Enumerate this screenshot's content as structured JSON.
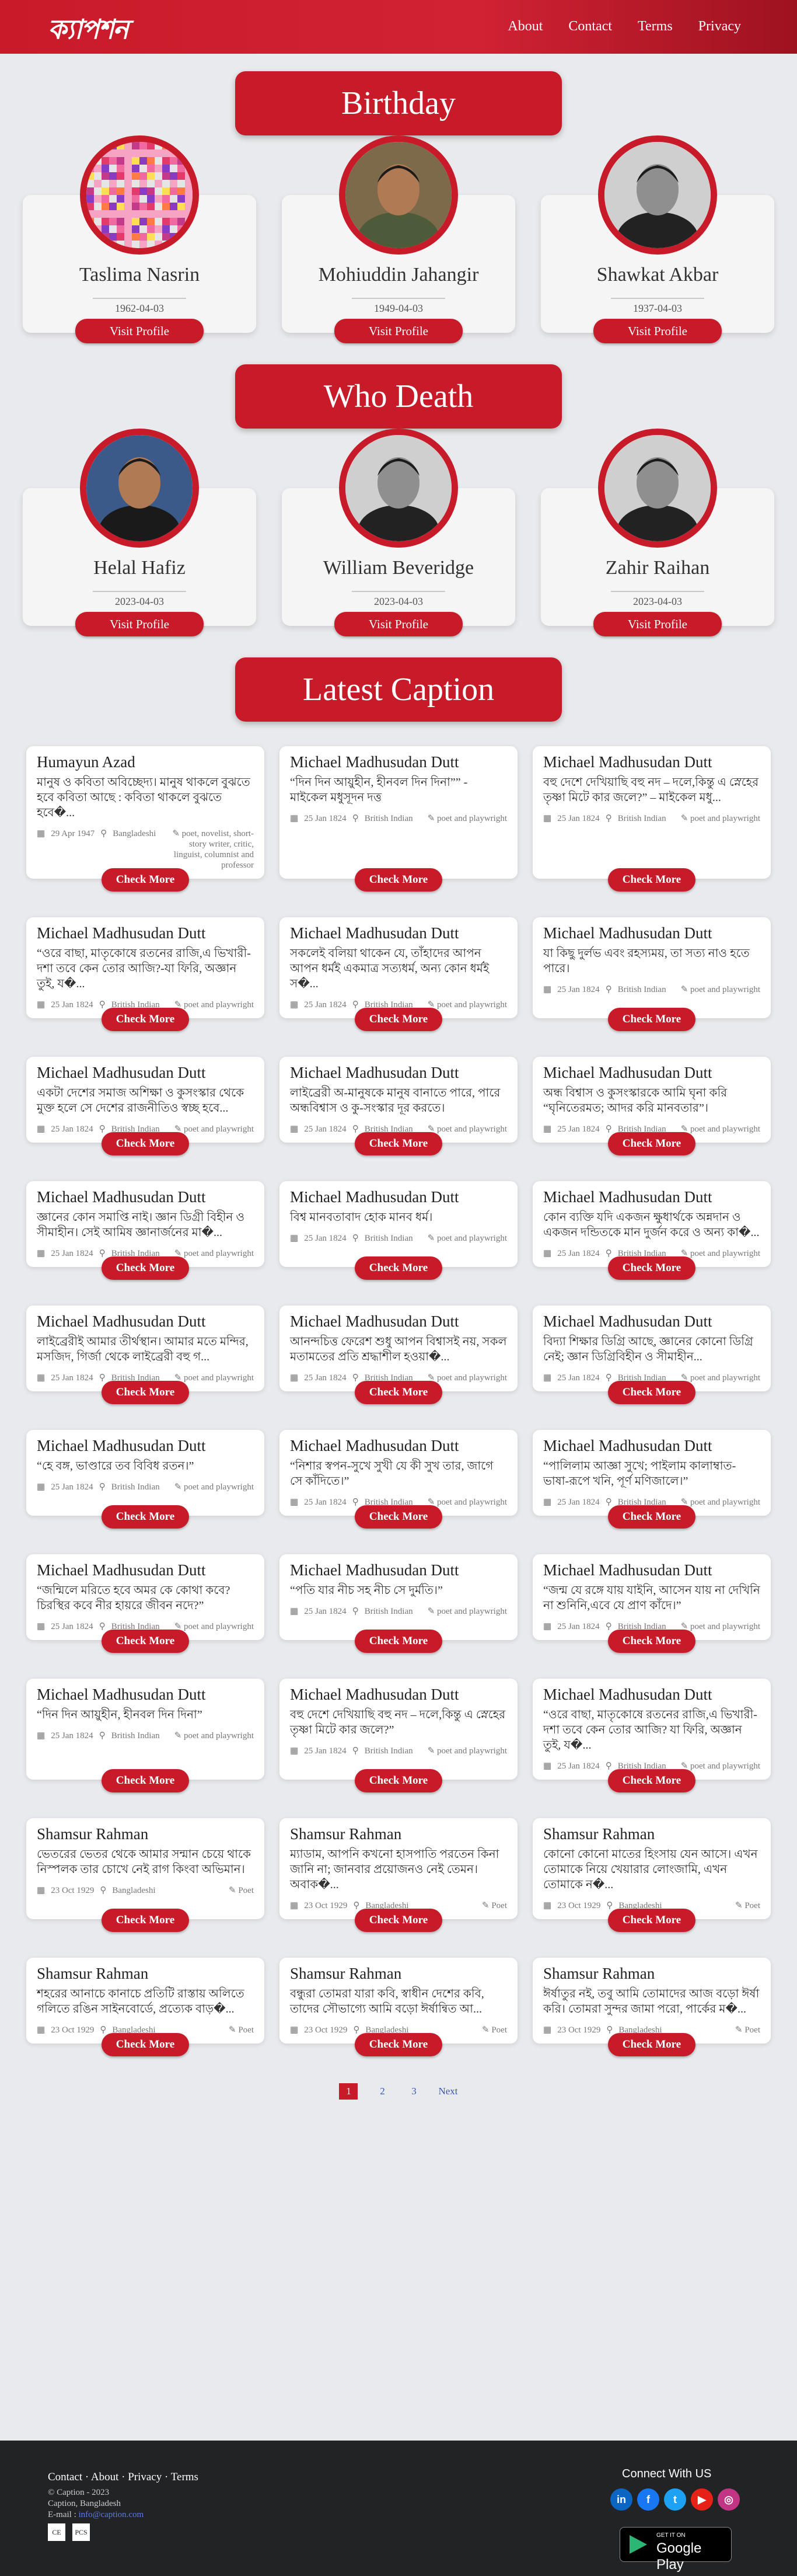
{
  "header": {
    "logo": "ক্যাপশন",
    "nav": [
      "About",
      "Contact",
      "Terms",
      "Privacy"
    ]
  },
  "birthday": {
    "title": "Birthday",
    "people": [
      {
        "name": "Taslima Nasrin",
        "date": "1962-04-03",
        "button": "Visit Profile",
        "photo": "portrait-collage"
      },
      {
        "name": "Mohiuddin Jahangir",
        "date": "1949-04-03",
        "button": "Visit Profile",
        "photo": "portrait-soldier"
      },
      {
        "name": "Shawkat Akbar",
        "date": "1937-04-03",
        "button": "Visit Profile",
        "photo": "portrait-bw"
      }
    ]
  },
  "death": {
    "title": "Who Death",
    "people": [
      {
        "name": "Helal Hafiz",
        "date": "2023-04-03",
        "button": "Visit Profile",
        "photo": "portrait-color"
      },
      {
        "name": "William Beveridge",
        "date": "2023-04-03",
        "button": "Visit Profile",
        "photo": "portrait-bw"
      },
      {
        "name": "Zahir Raihan",
        "date": "2023-04-03",
        "button": "Visit Profile",
        "photo": "portrait-bw"
      }
    ]
  },
  "captions": {
    "title": "Latest Caption",
    "more_label": "Check More",
    "cards": [
      {
        "author": "Humayun Azad",
        "text": "মানুষ ও কবিতা অবিচ্ছেদ্য। মানুষ থাকলে বুঝতে হবে কবিতা আছে : কবিতা থাকলে বুঝতে হবে�...",
        "date": "29 Apr 1947",
        "place": "Bangladeshi",
        "role": "poet, novelist, short-story writer, critic, linguist, columnist and professor"
      },
      {
        "author": "Michael Madhusudan Dutt",
        "text": "“দিন দিন আয়ুহীন, হীনবল দিন দিনা”” - মাইকেল মধুসূদন দত্ত",
        "date": "25 Jan 1824",
        "place": "British Indian",
        "role": "poet and playwright"
      },
      {
        "author": "Michael Madhusudan Dutt",
        "text": "বহু দেশে দেখিয়াছি বহু নদ – দলে,কিন্তু এ স্নেহের তৃষ্ণা মিটে কার জলে?” – মাইকেল মধু...",
        "date": "25 Jan 1824",
        "place": "British Indian",
        "role": "poet and playwright"
      },
      {
        "author": "Michael Madhusudan Dutt",
        "text": "“ওরে বাছা, মাতৃকোষে রতনের রাজি,এ ভিখারী-দশা তবে কেন তোর আজি?-যা ফিরি, অজ্ঞান তুই, য�...",
        "date": "25 Jan 1824",
        "place": "British Indian",
        "role": "poet and playwright"
      },
      {
        "author": "Michael Madhusudan Dutt",
        "text": "সকলেই বলিয়া থাকেন যে, তাঁহাদের আপন আপন ধর্মই একমাত্র সত্যধর্ম, অন্য কোন ধর্মই স�...",
        "date": "25 Jan 1824",
        "place": "British Indian",
        "role": "poet and playwright"
      },
      {
        "author": "Michael Madhusudan Dutt",
        "text": "যা কিছু দুর্লভ এবং রহস্যময়, তা সত্য নাও হতে পারে।",
        "date": "25 Jan 1824",
        "place": "British Indian",
        "role": "poet and playwright"
      },
      {
        "author": "Michael Madhusudan Dutt",
        "text": "একটা দেশের সমাজ অশিক্ষা ও কুসংস্কার থেকে মুক্ত হলে সে দেশের রাজনীতিও স্বচ্ছ হবে...",
        "date": "25 Jan 1824",
        "place": "British Indian",
        "role": "poet and playwright"
      },
      {
        "author": "Michael Madhusudan Dutt",
        "text": "লাইব্রেরী অ-মানুষকে মানুষ বানাতে পারে, পারে অন্ধবিশ্বাস ও কু-সংস্কার দূর করতে।",
        "date": "25 Jan 1824",
        "place": "British Indian",
        "role": "poet and playwright"
      },
      {
        "author": "Michael Madhusudan Dutt",
        "text": "অন্ধ বিশ্বাস ও কুসংস্কারকে আমি ঘৃনা করি “ঘৃনিতেরমত; আদর করি মানবতার”।",
        "date": "25 Jan 1824",
        "place": "British Indian",
        "role": "poet and playwright"
      },
      {
        "author": "Michael Madhusudan Dutt",
        "text": "জ্ঞানের কোন সমাপ্তি নাই। জ্ঞান ডিগ্রী বিহীন ও সীমাহীন। সেই আমিষ জ্ঞানার্জনের মা�...",
        "date": "25 Jan 1824",
        "place": "British Indian",
        "role": "poet and playwright"
      },
      {
        "author": "Michael Madhusudan Dutt",
        "text": "বিশ্ব মানবতাবাদ হোক মানব ধর্ম।",
        "date": "25 Jan 1824",
        "place": "British Indian",
        "role": "poet and playwright"
      },
      {
        "author": "Michael Madhusudan Dutt",
        "text": "কোন ব্যক্তি যদি একজন ক্ষুধার্থকে অন্নদান ও একজন দন্ডিতকে মান দুর্জন করে ও অন্য কা�...",
        "date": "25 Jan 1824",
        "place": "British Indian",
        "role": "poet and playwright"
      },
      {
        "author": "Michael Madhusudan Dutt",
        "text": "লাইব্রেরীই আমার তীর্থস্থান। আমার মতে মন্দির, মসজিদ, গির্জা থেকে লাইব্রেরী বহু গ...",
        "date": "25 Jan 1824",
        "place": "British Indian",
        "role": "poet and playwright"
      },
      {
        "author": "Michael Madhusudan Dutt",
        "text": "আনন্দচিত্ত ফেরেশ শুধু আপন বিশ্বাসই নয়, সকল মতামতের প্রতি শ্রদ্ধাশীল হওয়া�...",
        "date": "25 Jan 1824",
        "place": "British Indian",
        "role": "poet and playwright"
      },
      {
        "author": "Michael Madhusudan Dutt",
        "text": "বিদ্যা শিক্ষার ডিগ্রি আছে, জ্ঞানের কোনো ডিগ্রি নেই; জ্ঞান ডিগ্রিবিহীন ও সীমাহীন...",
        "date": "25 Jan 1824",
        "place": "British Indian",
        "role": "poet and playwright"
      },
      {
        "author": "Michael Madhusudan Dutt",
        "text": "“হে বঙ্গ, ভাণ্ডারে তব বিবিধ রতন।”",
        "date": "25 Jan 1824",
        "place": "British Indian",
        "role": "poet and playwright"
      },
      {
        "author": "Michael Madhusudan Dutt",
        "text": "“নিশার স্বপন-সুখে সুখী যে কী সুখ তার, জাগে সে কাঁদিতে।”",
        "date": "25 Jan 1824",
        "place": "British Indian",
        "role": "poet and playwright"
      },
      {
        "author": "Michael Madhusudan Dutt",
        "text": "“পালিলাম আজ্ঞা সুখে; পাইলাম কালাম্বাত-ভাষা-রূপে খনি, পূর্ণ মণিজালে।”",
        "date": "25 Jan 1824",
        "place": "British Indian",
        "role": "poet and playwright"
      },
      {
        "author": "Michael Madhusudan Dutt",
        "text": "“জন্মিলে মরিতে হবে অমর কে কোথা কবে? চিরস্থির কবে নীর হায়রে জীবন নদে?”",
        "date": "25 Jan 1824",
        "place": "British Indian",
        "role": "poet and playwright"
      },
      {
        "author": "Michael Madhusudan Dutt",
        "text": "“পতি যার নীচ সহ নীচ সে দুর্মতি।”",
        "date": "25 Jan 1824",
        "place": "British Indian",
        "role": "poet and playwright"
      },
      {
        "author": "Michael Madhusudan Dutt",
        "text": "“জন্ম যে রঙ্গে যায় যাইনি, আসেন যায় না দেখিনি না শুনিনি,এবে যে প্রাণ কাঁদে।”",
        "date": "25 Jan 1824",
        "place": "British Indian",
        "role": "poet and playwright"
      },
      {
        "author": "Michael Madhusudan Dutt",
        "text": "“দিন দিন আয়ুহীন, হীনবল দিন দিনা”",
        "date": "25 Jan 1824",
        "place": "British Indian",
        "role": "poet and playwright"
      },
      {
        "author": "Michael Madhusudan Dutt",
        "text": "বহু দেশে দেখিয়াছি বহু নদ – দলে,কিন্তু এ স্নেহের তৃষ্ণা মিটে কার জলে?”",
        "date": "25 Jan 1824",
        "place": "British Indian",
        "role": "poet and playwright"
      },
      {
        "author": "Michael Madhusudan Dutt",
        "text": "“ওরে বাছা, মাতৃকোষে রতনের রাজি,এ ভিখারী-দশা তবে কেন তোর আজি? যা ফিরি, অজ্ঞান তুই, য�...",
        "date": "25 Jan 1824",
        "place": "British Indian",
        "role": "poet and playwright"
      },
      {
        "author": "Shamsur Rahman",
        "text": "ভেতরের ভেতর থেকে আমার সন্মান চেয়ে থাকে নিস্পলক তার চোখে নেই রাগ কিংবা অভিমান।",
        "date": "23 Oct 1929",
        "place": "Bangladeshi",
        "role": "Poet"
      },
      {
        "author": "Shamsur Rahman",
        "text": "ম্যাডাম, আপনি কখনো হাসপাতি পরতেন কিনা জানি না; জানবার প্রয়োজনও নেই তেমন। অবাক�...",
        "date": "23 Oct 1929",
        "place": "Bangladeshi",
        "role": "Poet"
      },
      {
        "author": "Shamsur Rahman",
        "text": "কোনো কোনো মাতের হিংসায় যেন আসে। এখন তোমাকে নিয়ে খেয়ারার লোংজামি, এখন তোমাকে ন�...",
        "date": "23 Oct 1929",
        "place": "Bangladeshi",
        "role": "Poet"
      },
      {
        "author": "Shamsur Rahman",
        "text": "শহরের আনাচে কানাচে প্রতিটি রাস্তায় অলিতে গলিতে রঙিন সাইনবোর্ডে, প্রত্যেক বাড়�...",
        "date": "23 Oct 1929",
        "place": "Bangladeshi",
        "role": "Poet"
      },
      {
        "author": "Shamsur Rahman",
        "text": "বন্ধুরা তোমরা যারা কবি, স্বাধীন দেশের কবি, তাদের সৌভাগ্যে আমি বড়ো ঈর্ষান্বিত আ...",
        "date": "23 Oct 1929",
        "place": "Bangladeshi",
        "role": "Poet"
      },
      {
        "author": "Shamsur Rahman",
        "text": "ঈর্ষাতুর নই, তবু আমি তোমাদের আজ বড়ো ঈর্ষা করি। তোমরা সুন্দর জামা পরো, পার্কের ম�...",
        "date": "23 Oct 1929",
        "place": "Bangladeshi",
        "role": "Poet"
      }
    ]
  },
  "pagination": {
    "pages": [
      "1",
      "2",
      "3"
    ],
    "next": "Next",
    "active": "1"
  },
  "footer": {
    "links": "Contact · About · Privacy · Terms",
    "copy": "© Caption - 2023",
    "line2": "Caption, Bangladesh",
    "email_label": "E-mail :",
    "email": "info@caption.com",
    "badges": [
      "CE",
      "PCS"
    ],
    "connect": "Connect With US",
    "socials": [
      "linkedin-icon",
      "facebook-icon",
      "twitter-icon",
      "youtube-icon",
      "instagram-icon"
    ],
    "store_small": "GET IT ON",
    "store_big": "Google Play"
  },
  "colors": {
    "accent": "#c81b2a",
    "background": "#e9eaed",
    "footer": "#222325"
  }
}
